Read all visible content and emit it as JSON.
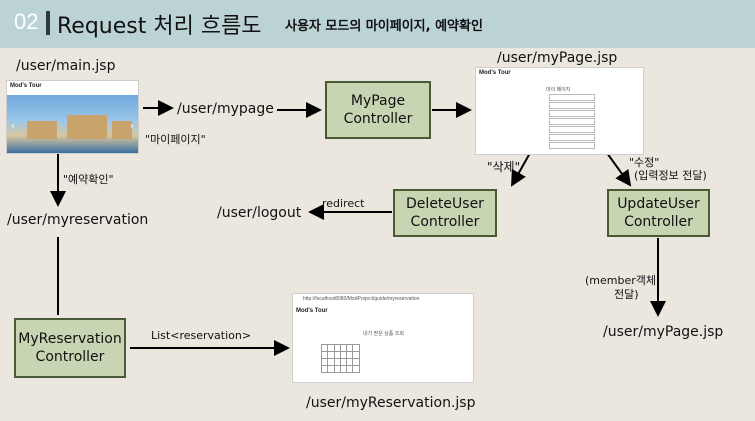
{
  "header": {
    "number": "02",
    "title": "Request 처리 흐름도",
    "subtitle": "사용자 모드의 마이페이지, 예약확인"
  },
  "labels": {
    "main_jsp": "/user/main.jsp",
    "mypage_url": "/user/mypage",
    "mypage_jsp_top": "/user/myPage.jsp",
    "mypage_link": "\"마이페이지\"",
    "reservation_link": "\"예약확인\"",
    "myreservation_url": "/user/myreservation",
    "logout_url": "/user/logout",
    "redirect": "redirect",
    "delete_action": "\"삭제\"",
    "update_action": "\"수정\"",
    "update_action_detail": "(입력정보 전달)",
    "member_obj_line1": "(member객체",
    "member_obj_line2": "전달)",
    "mypage_jsp_bottom": "/user/myPage.jsp",
    "list_reservation": "List<reservation>",
    "myreservation_jsp": "/user/myReservation.jsp"
  },
  "boxes": {
    "mypage_controller": [
      "MyPage",
      "Controller"
    ],
    "deleteuser_controller": [
      "DeleteUser",
      "Controller"
    ],
    "updateuser_controller": [
      "UpdateUser",
      "Controller"
    ],
    "myreservation_controller": [
      "MyReservation",
      "Controller"
    ]
  },
  "screens": {
    "main_brand": "Mod's Tour",
    "mypage_brand": "Mod's Tour",
    "mypage_heading": "마이 페이지",
    "reservation_brand": "Mod's Tour",
    "reservation_heading": "내가 받은 상품 조회",
    "reservation_url": "http://localhost8080/ModProject/guide/myreservation"
  },
  "colors": {
    "header_bg": "#bcd3d6",
    "box_fill": "#c8d5b2",
    "box_border": "#4a5a35",
    "page_bg": "#ebe7df"
  }
}
